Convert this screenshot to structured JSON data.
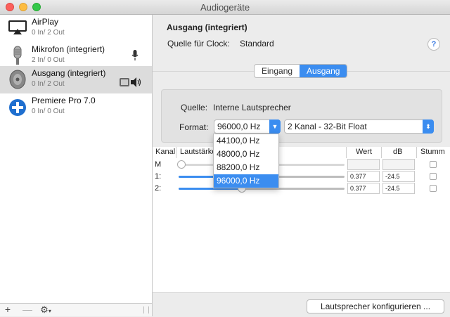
{
  "window": {
    "title": "Audiogeräte"
  },
  "sidebar": {
    "devices": [
      {
        "name": "AirPlay",
        "channels": "0 In/ 2 Out",
        "icon": "airplay-icon"
      },
      {
        "name": "Mikrofon (integriert)",
        "channels": "2 In/ 0 Out",
        "icon": "microphone-icon"
      },
      {
        "name": "Ausgang (integriert)",
        "channels": "0 In/ 2 Out",
        "icon": "speaker-icon",
        "selected": true
      },
      {
        "name": "Premiere Pro 7.0",
        "channels": "0 In/ 0 Out",
        "icon": "plus-circle-icon"
      }
    ],
    "bottom": {
      "add": "+",
      "remove": "—",
      "gear": "⚙"
    }
  },
  "main": {
    "title": "Ausgang (integriert)",
    "clock_label": "Quelle für Clock:",
    "clock_value": "Standard",
    "help": "?",
    "tabs": [
      {
        "label": "Eingang"
      },
      {
        "label": "Ausgang",
        "active": true
      }
    ],
    "source_label": "Quelle:",
    "source_value": "Interne Lautsprecher",
    "format_label": "Format:",
    "format_rate": "96000,0 Hz",
    "format_channels": "2 Kanal - 32-Bit Float",
    "format_rate_options": [
      "44100,0 Hz",
      "48000,0 Hz",
      "88200,0 Hz",
      "96000,0 Hz"
    ],
    "table": {
      "headers": {
        "channel": "Kanal",
        "volume": "Lautstärke",
        "value": "Wert",
        "db": "dB",
        "mute": "Stumm"
      },
      "rows": [
        {
          "channel": "M",
          "level": 0.0,
          "value": "",
          "db": ""
        },
        {
          "channel": "1:",
          "level": 0.377,
          "value": "0.377",
          "db": "-24.5"
        },
        {
          "channel": "2:",
          "level": 0.377,
          "value": "0.377",
          "db": "-24.5"
        }
      ]
    },
    "configure_button": "Lautsprecher konfigurieren ..."
  },
  "colors": {
    "accent": "#3b8df0",
    "selection_bg": "#dcdcdc"
  }
}
